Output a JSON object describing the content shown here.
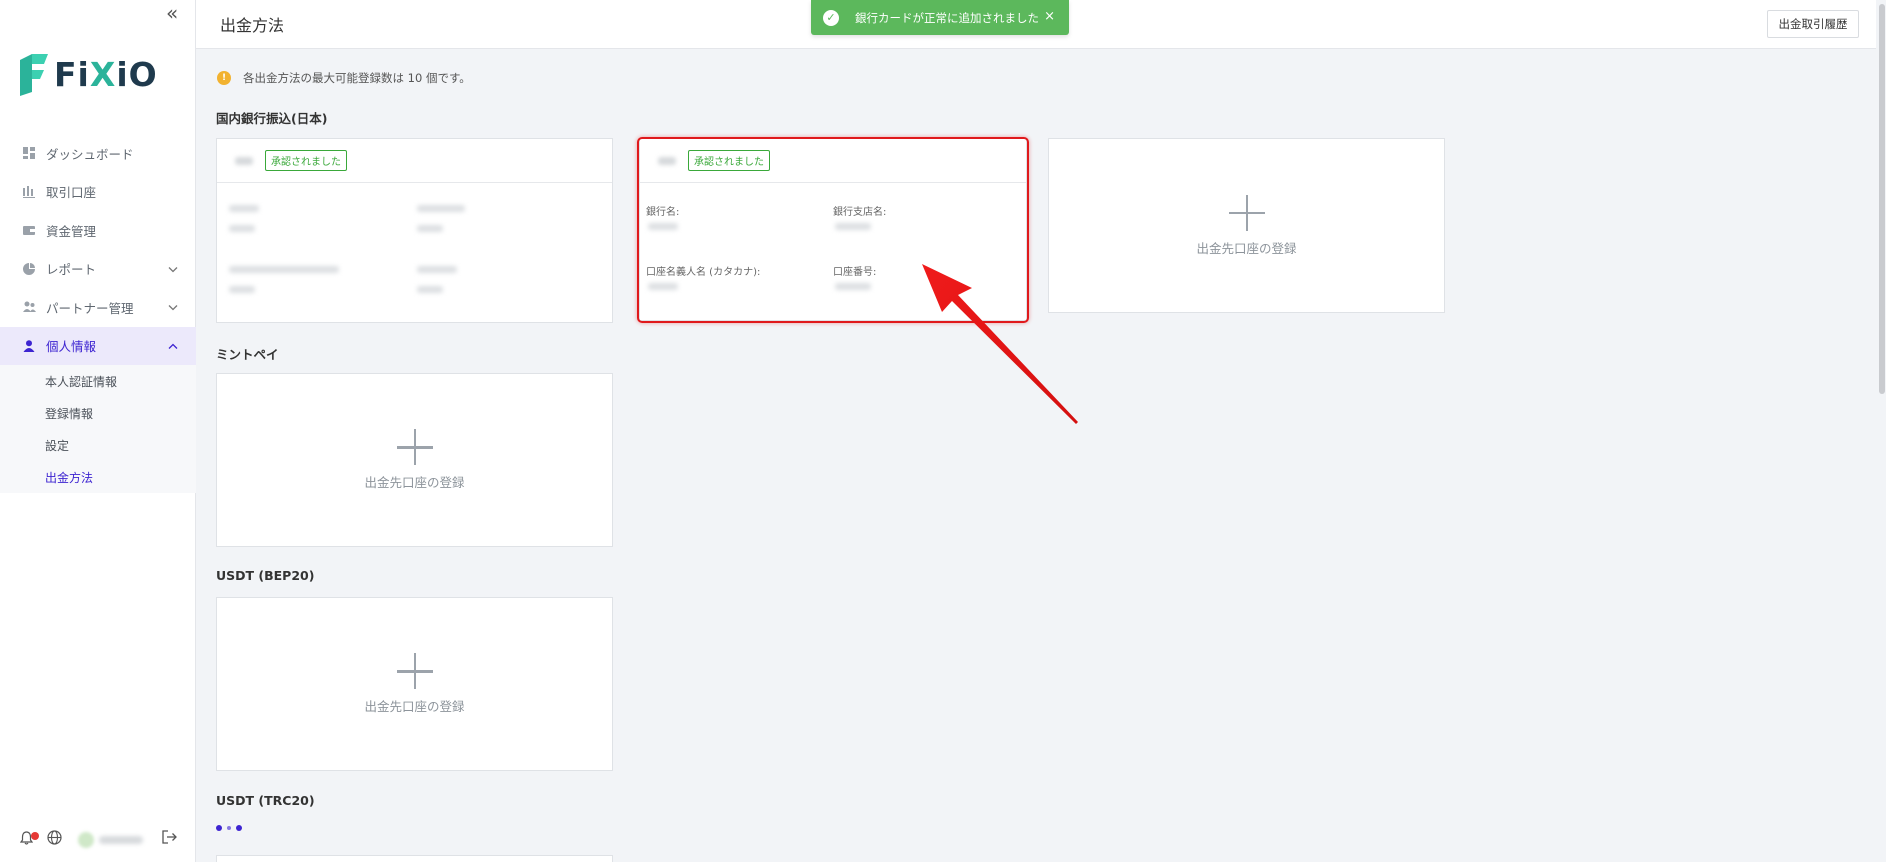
{
  "app": {
    "logo_text_a": "F",
    "logo_text_b": "i",
    "logo_text_c": "X",
    "logo_text_d": "iO",
    "collapse_icon": "«"
  },
  "sidebar": {
    "items": [
      {
        "label": "ダッシュボード",
        "icon": "dashboard-icon"
      },
      {
        "label": "取引口座",
        "icon": "trading-account-icon"
      },
      {
        "label": "資金管理",
        "icon": "wallet-icon"
      },
      {
        "label": "レポート",
        "icon": "report-icon",
        "has_chevron": true
      },
      {
        "label": "パートナー管理",
        "icon": "partner-icon",
        "has_chevron": true
      },
      {
        "label": "個人情報",
        "icon": "user-icon",
        "has_chevron": true,
        "active": true
      }
    ],
    "sub_items": [
      {
        "label": "本人認証情報"
      },
      {
        "label": "登録情報"
      },
      {
        "label": "設定"
      },
      {
        "label": "出金方法",
        "active": true
      }
    ]
  },
  "header": {
    "title": "出金方法",
    "history_button": "出金取引履歴"
  },
  "toast": {
    "message": "銀行カードが正常に追加されました",
    "close": "×"
  },
  "notice": {
    "text": "各出金方法の最大可能登録数は 10 個です。"
  },
  "sections": {
    "domestic": {
      "title": "国内銀行振込(日本)",
      "cards": [
        {
          "badge": "承認されました"
        },
        {
          "badge": "承認されました",
          "bank_name_label": "銀行名:",
          "branch_label": "銀行支店名:",
          "holder_label": "口座名義人名 (カタカナ):",
          "account_no_label": "口座番号:"
        }
      ],
      "add_label": "出金先口座の登録"
    },
    "mintpay": {
      "title": "ミントペイ",
      "add_label": "出金先口座の登録"
    },
    "bep20": {
      "title": "USDT (BEP20)",
      "add_label": "出金先口座の登録"
    },
    "trc20": {
      "title": "USDT (TRC20)"
    }
  },
  "colors": {
    "accent": "#3d24d1",
    "success": "#5cb85c",
    "badge_green": "#3aa83a",
    "highlight_red": "#e0191c",
    "info_yellow": "#f2b230"
  }
}
